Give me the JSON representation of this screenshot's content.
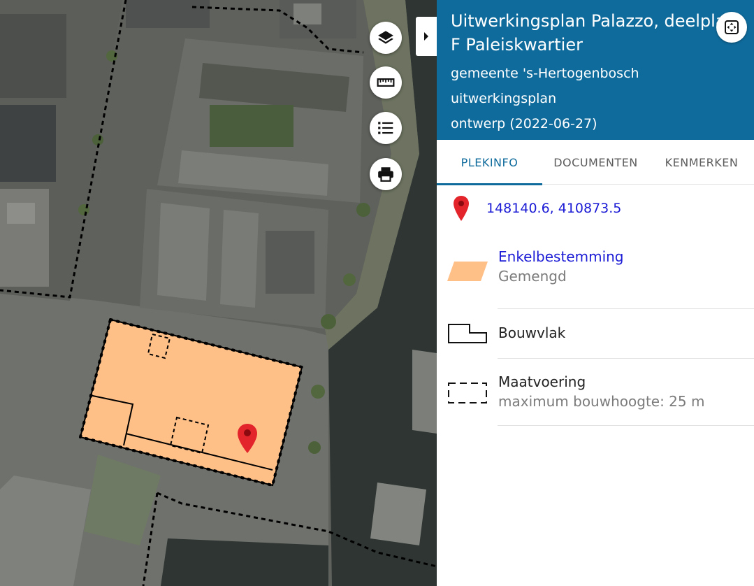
{
  "panel": {
    "title": "Uitwerkingsplan Palazzo, deelplan F Paleiskwartier",
    "municipality": "gemeente 's-Hertogenbosch",
    "plan_type": "uitwerkingsplan",
    "status": "ontwerp (2022-06-27)"
  },
  "tabs": [
    {
      "label": "PLEKINFO"
    },
    {
      "label": "DOCUMENTEN"
    },
    {
      "label": "KENMERKEN"
    }
  ],
  "location": {
    "coordinates": "148140.6, 410873.5"
  },
  "legend": [
    {
      "title": "Enkelbestemming",
      "subtitle": "Gemengd",
      "color": "#ffc088"
    },
    {
      "title": "Bouwvlak",
      "subtitle": ""
    },
    {
      "title": "Maatvoering",
      "subtitle": "maximum bouwhoogte: 25 m"
    }
  ],
  "map_controls": [
    {
      "icon": "layers-icon"
    },
    {
      "icon": "ruler-icon"
    },
    {
      "icon": "list-icon"
    },
    {
      "icon": "printer-icon"
    }
  ],
  "colors": {
    "header": "#0f6b9c",
    "link": "#1b1bd6",
    "plan_fill": "#ffc088",
    "marker": "#e3242b"
  }
}
